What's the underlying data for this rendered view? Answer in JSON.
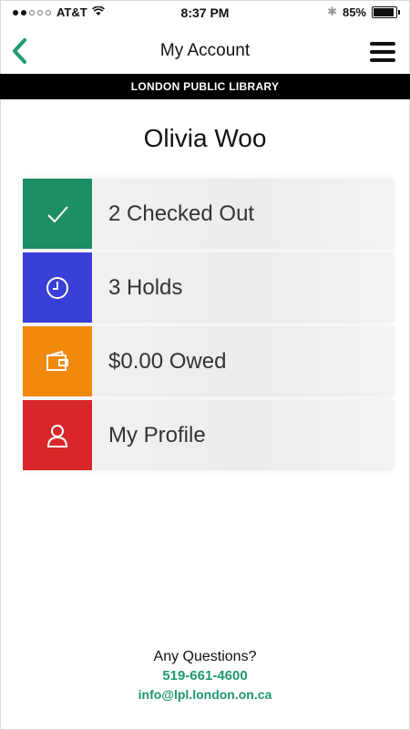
{
  "status_bar": {
    "carrier": "AT&T",
    "time": "8:37 PM",
    "battery": "85%",
    "battery_level": 0.85,
    "icons": [
      "signal-dots-icon",
      "wifi-icon",
      "bluetooth-icon",
      "battery-icon"
    ]
  },
  "nav": {
    "title": "My Account",
    "back_icon": "chevron-left-icon",
    "menu_icon": "hamburger-menu-icon"
  },
  "banner": "LONDON PUBLIC LIBRARY",
  "user": {
    "name": "Olivia Woo"
  },
  "menu": {
    "items": [
      {
        "label": "2 Checked Out",
        "icon": "checkmark-icon",
        "color": "#1e8f63"
      },
      {
        "label": "3 Holds",
        "icon": "clock-icon",
        "color": "#3a3fd8"
      },
      {
        "label": "$0.00 Owed",
        "icon": "wallet-icon",
        "color": "#f0890c"
      },
      {
        "label": "My Profile",
        "icon": "person-icon",
        "color": "#d9262b"
      }
    ]
  },
  "footer": {
    "question": "Any Questions?",
    "phone": "519-661-4600",
    "email": "info@lpl.london.on.ca"
  },
  "colors": {
    "accent": "#1f9a6f",
    "banner_bg": "#000000"
  }
}
